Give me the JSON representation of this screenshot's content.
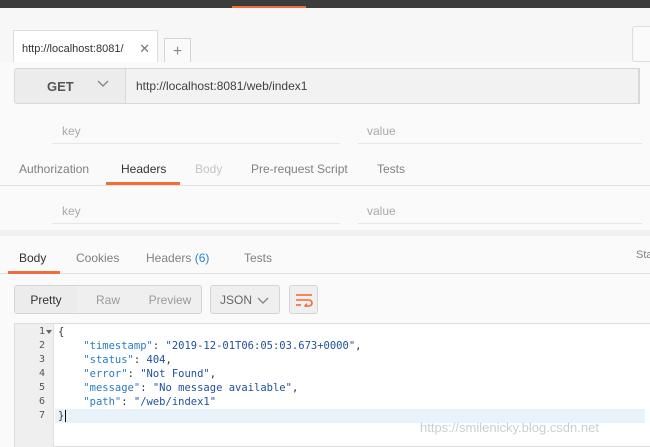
{
  "tabs": [
    {
      "label": "http://localhost:8081/",
      "close": "✕"
    }
  ],
  "add_tab_label": "+",
  "request": {
    "method": "GET",
    "url": "http://localhost:8081/web/index1"
  },
  "params": {
    "key_placeholder": "key",
    "value_placeholder": "value"
  },
  "request_tabs": [
    {
      "label": "Authorization"
    },
    {
      "label": "Headers"
    },
    {
      "label": "Body"
    },
    {
      "label": "Pre-request Script"
    },
    {
      "label": "Tests"
    }
  ],
  "headers": {
    "key_placeholder": "key",
    "value_placeholder": "value"
  },
  "response_tabs": {
    "body": "Body",
    "cookies": "Cookies",
    "headers": "Headers",
    "headers_count": "(6)",
    "tests": "Tests",
    "status_partial": "Sta"
  },
  "view": {
    "options": [
      "Pretty",
      "Raw",
      "Preview"
    ],
    "selected": "Pretty",
    "format": "JSON"
  },
  "editor": {
    "line_numbers": [
      "1",
      "2",
      "3",
      "4",
      "5",
      "6",
      "7"
    ],
    "timestamp_key": "\"timestamp\"",
    "timestamp_val": "\"2019-12-01T06:05:03.673+0000\"",
    "status_key": "\"status\"",
    "status_val": "404",
    "error_key": "\"error\"",
    "error_val": "\"Not Found\"",
    "message_key": "\"message\"",
    "message_val": "\"No message available\"",
    "path_key": "\"path\"",
    "path_val": "\"/web/index1\""
  },
  "watermark": "https://smilenicky.blog.csdn.net",
  "colors": {
    "accent": "#f26b3a",
    "link": "#2a85c9"
  }
}
